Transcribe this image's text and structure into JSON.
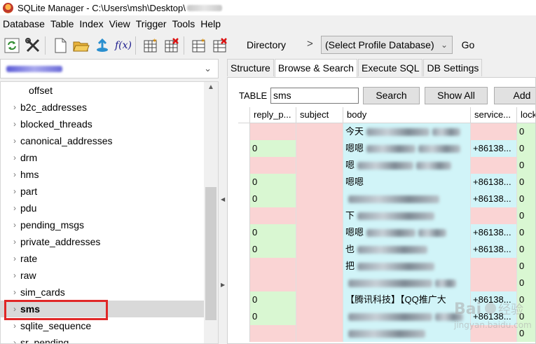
{
  "window": {
    "title": "SQLite Manager - C:\\Users\\msh\\Desktop\\"
  },
  "menu": [
    "Database",
    "Table",
    "Index",
    "View",
    "Trigger",
    "Tools",
    "Help"
  ],
  "toolbar": {
    "icons": [
      "refresh-icon",
      "connect-tools-icon",
      "new-database-icon",
      "open-database-icon",
      "attach-icon",
      "function-icon",
      "create-table-icon",
      "drop-table-icon",
      "create-index-icon",
      "drop-index-icon"
    ],
    "function_label": "f(x)",
    "directory_label": "Directory",
    "directory_arrow": ">",
    "profile_select": "(Select Profile Database)",
    "go_label": "Go"
  },
  "sidebar": {
    "items": [
      {
        "label": "offset",
        "child": true
      },
      {
        "label": "b2c_addresses"
      },
      {
        "label": "blocked_threads"
      },
      {
        "label": "canonical_addresses"
      },
      {
        "label": "drm"
      },
      {
        "label": "hms"
      },
      {
        "label": "part"
      },
      {
        "label": "pdu"
      },
      {
        "label": "pending_msgs"
      },
      {
        "label": "private_addresses"
      },
      {
        "label": "rate"
      },
      {
        "label": "raw"
      },
      {
        "label": "sim_cards"
      },
      {
        "label": "sms",
        "selected": true
      },
      {
        "label": "sqlite_sequence"
      },
      {
        "label": "sr_pending"
      }
    ]
  },
  "tabs": [
    "Structure",
    "Browse & Search",
    "Execute SQL",
    "DB Settings"
  ],
  "browse": {
    "table_label": "TABLE",
    "table_value": "sms",
    "search_label": "Search",
    "show_all_label": "Show All",
    "add_label": "Add"
  },
  "grid": {
    "columns": [
      "reply_p...",
      "subject",
      "body",
      "service...",
      "lock"
    ],
    "rows": [
      {
        "reply": "",
        "body": "今天",
        "service": "",
        "lock": "0"
      },
      {
        "reply": "0",
        "body": "嗯嗯",
        "service": "+86138...",
        "lock": "0"
      },
      {
        "reply": "",
        "body": "嗯",
        "service": "",
        "lock": "0"
      },
      {
        "reply": "0",
        "body": "嗯嗯",
        "service": "+86138...",
        "lock": "0"
      },
      {
        "reply": "0",
        "body": "",
        "service": "+86138...",
        "lock": "0"
      },
      {
        "reply": "",
        "body": "下",
        "service": "",
        "lock": "0"
      },
      {
        "reply": "0",
        "body": "嗯嗯",
        "service": "+86138...",
        "lock": "0"
      },
      {
        "reply": "0",
        "body": "也",
        "service": "+86138...",
        "lock": "0"
      },
      {
        "reply": "",
        "body": "把",
        "service": "",
        "lock": "0"
      },
      {
        "reply": "",
        "body": "",
        "service": "",
        "lock": "0"
      },
      {
        "reply": "0",
        "body": "【腾讯科技】【QQ推广大",
        "service": "+86138...",
        "lock": "0"
      },
      {
        "reply": "0",
        "body": "",
        "service": "+86138...",
        "lock": "0"
      },
      {
        "reply": "",
        "body": "",
        "service": "",
        "lock": "0"
      }
    ]
  },
  "colors": {
    "green": "#d9f7d2",
    "pink": "#fad4d4",
    "cyan": "#d1f4f8",
    "highlight": "#e02727"
  }
}
